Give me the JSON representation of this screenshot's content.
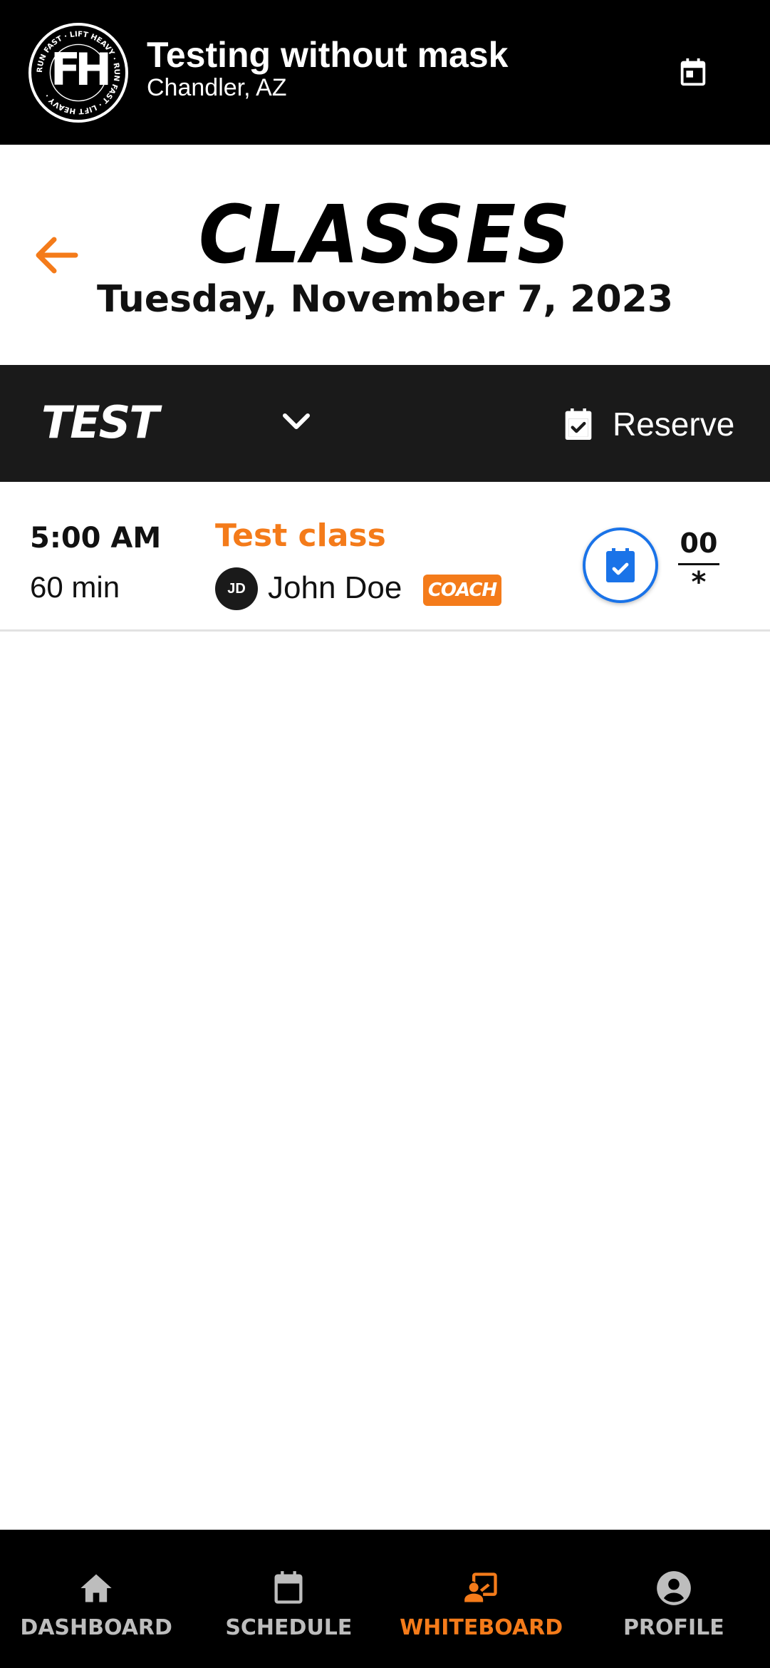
{
  "header": {
    "logo_text": "FH",
    "logo_ring_text": "RUN FAST · LIFT HEAVY · RUN FAST · LIFT HEAVY ·",
    "title": "Testing without mask",
    "subtitle": "Chandler, AZ",
    "calendar_icon": "calendar-icon"
  },
  "page": {
    "title": "CLASSES",
    "date": "Tuesday, November 7, 2023",
    "back_icon": "arrow-left-icon"
  },
  "filter": {
    "selected": "TEST",
    "dropdown_icon": "chevron-down-icon",
    "reserve_label": "Reserve",
    "reserve_icon": "calendar-check-icon"
  },
  "classes": [
    {
      "time": "5:00 AM",
      "duration": "60 min",
      "name": "Test class",
      "coach_initials": "JD",
      "coach_name": "John Doe",
      "coach_badge": "COACH",
      "spots_taken": "00",
      "spots_total": "*"
    }
  ],
  "nav": [
    {
      "label": "DASHBOARD",
      "icon": "home-icon"
    },
    {
      "label": "SCHEDULE",
      "icon": "calendar-icon"
    },
    {
      "label": "WHITEBOARD",
      "icon": "whiteboard-icon"
    },
    {
      "label": "PROFILE",
      "icon": "profile-icon"
    }
  ],
  "colors": {
    "accent": "#f47b1a",
    "reserve_blue": "#1a73e8",
    "nav_inactive": "#bdbdbd",
    "header_bg": "#000000",
    "filter_bg": "#1a1a1a"
  }
}
